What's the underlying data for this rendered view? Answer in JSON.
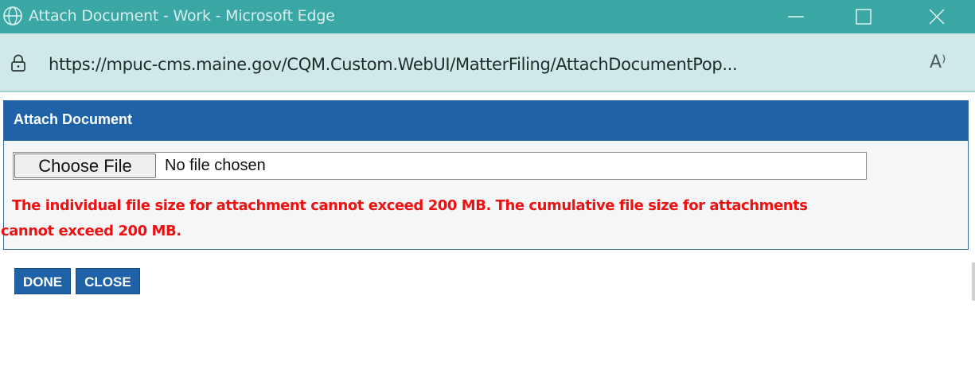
{
  "window": {
    "title": "Attach Document - Work - Microsoft Edge",
    "controls": {
      "minimize": "minimize-icon",
      "maximize": "maximize-icon",
      "close": "close-icon"
    },
    "accent": "#3aa7a4"
  },
  "address": {
    "url": "https://mpuc-cms.maine.gov/CQM.Custom.WebUI/MatterFiling/AttachDocumentPop...",
    "read_aloud": "A⁾"
  },
  "panel": {
    "header": "Attach Document",
    "header_color": "#1f62a8",
    "file_input": {
      "button_label": "Choose File",
      "status": "No file chosen"
    },
    "warning_line1": "The individual file size for attachment cannot exceed 200 MB. The cumulative file size for attachments",
    "warning_line2": "cannot exceed 200 MB.",
    "warning_color": "#ee1111"
  },
  "actions": {
    "done_label": "DONE",
    "close_label": "CLOSE"
  }
}
